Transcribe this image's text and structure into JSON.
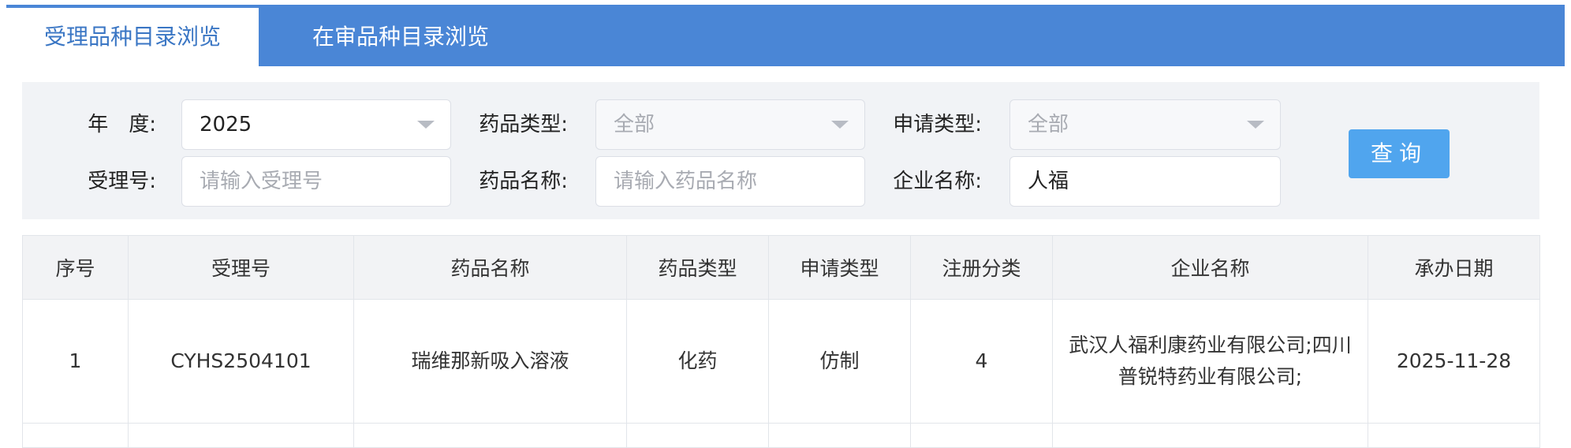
{
  "tabs": [
    {
      "label": "受理品种目录浏览",
      "active": true
    },
    {
      "label": "在审品种目录浏览",
      "active": false
    }
  ],
  "filters": {
    "year": {
      "label": "年　度:",
      "value": "2025"
    },
    "drug_type": {
      "label": "药品类型:",
      "value": "全部"
    },
    "apply_type": {
      "label": "申请类型:",
      "value": "全部"
    },
    "accept_no": {
      "label": "受理号:",
      "placeholder": "请输入受理号",
      "value": ""
    },
    "drug_name": {
      "label": "药品名称:",
      "placeholder": "请输入药品名称",
      "value": ""
    },
    "company": {
      "label": "企业名称:",
      "value": "人福"
    },
    "query_button": "查询"
  },
  "table": {
    "columns": [
      "序号",
      "受理号",
      "药品名称",
      "药品类型",
      "申请类型",
      "注册分类",
      "企业名称",
      "承办日期"
    ],
    "rows": [
      {
        "index": "1",
        "accept_no": "CYHS2504101",
        "drug_name": "瑞维那新吸入溶液",
        "drug_type": "化药",
        "apply_type": "仿制",
        "reg_class": "4",
        "company": "武汉人福利康药业有限公司;四川普锐特药业有限公司;",
        "date": "2025-11-28"
      }
    ]
  },
  "colors": {
    "tab_bar": "#4a86d6",
    "active_tab_text": "#3a76c4",
    "query_button": "#50a5ee",
    "panel_bg": "#f1f3f6"
  }
}
